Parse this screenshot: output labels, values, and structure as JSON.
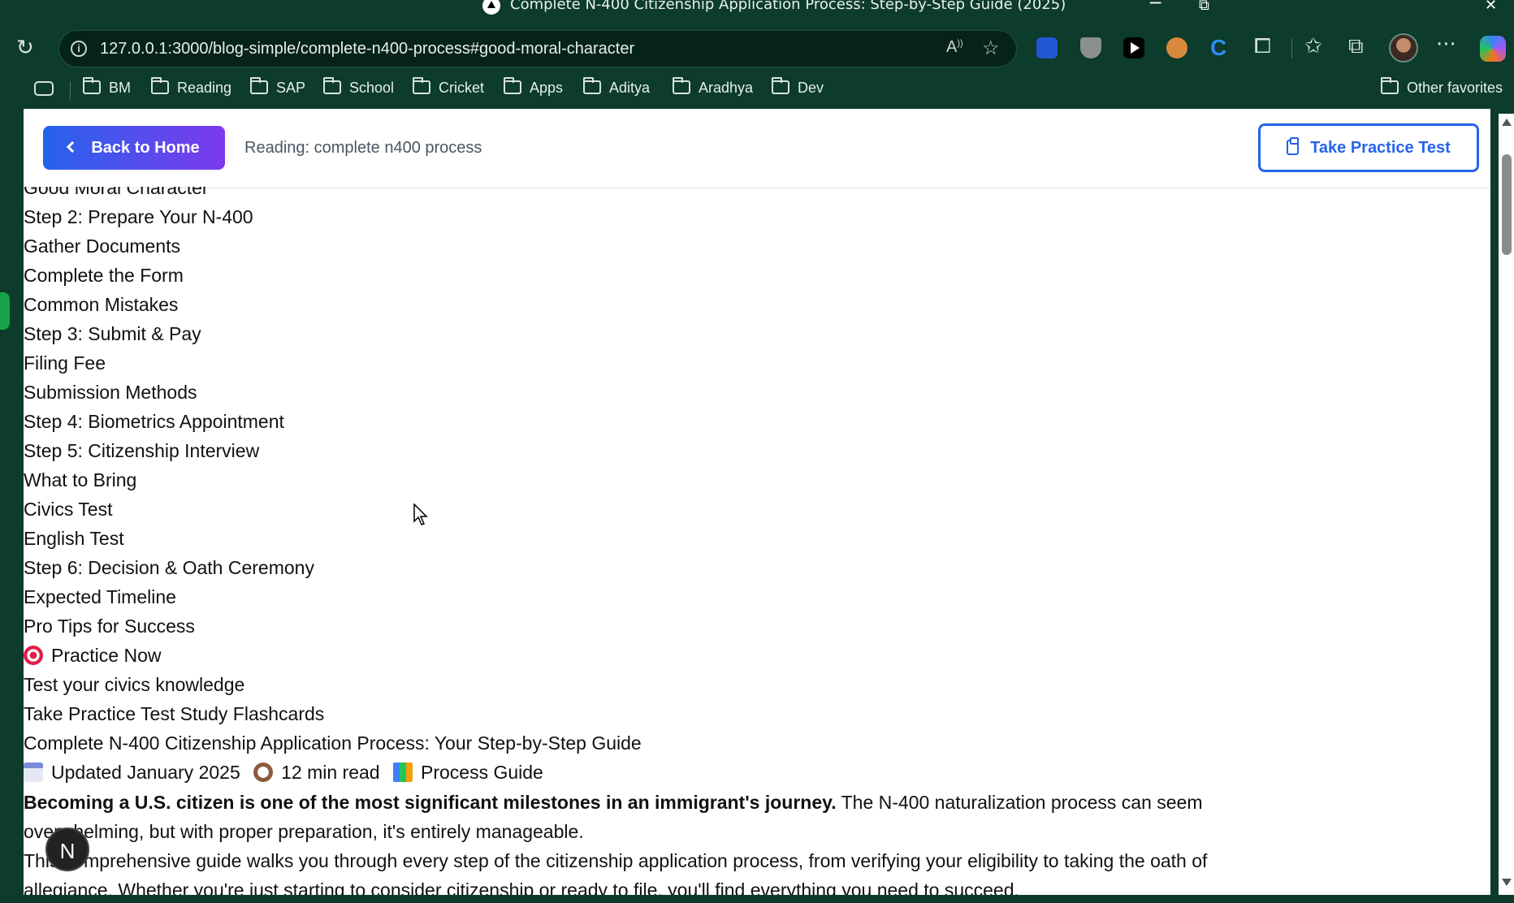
{
  "window": {
    "title": "Complete N-400 Citizenship Application Process: Step-by-Step Guide (2025)",
    "minimize": "─",
    "restore": "⧉",
    "close": "✕"
  },
  "toolbar": {
    "url": "127.0.0.1:3000/blog-simple/complete-n400-process#good-moral-character",
    "read_aloud": "A⁾",
    "more": "···"
  },
  "bookmarks": {
    "items": [
      "BM",
      "Reading",
      "SAP",
      "School",
      "Cricket",
      "Apps",
      "Aditya",
      "Aradhya",
      "Dev"
    ],
    "other": "Other favorites"
  },
  "header": {
    "back_label": "Back to Home",
    "reading_label": "Reading: complete n400 process",
    "practice_label": "Take Practice Test"
  },
  "content": {
    "toc": [
      "Good Moral Character",
      "Step 2: Prepare Your N-400",
      "Gather Documents",
      "Complete the Form",
      "Common Mistakes",
      "Step 3: Submit & Pay",
      "Filing Fee",
      "Submission Methods",
      "Step 4: Biometrics Appointment",
      "Step 5: Citizenship Interview",
      "What to Bring",
      "Civics Test",
      "English Test",
      "Step 6: Decision & Oath Ceremony",
      "Expected Timeline",
      "Pro Tips for Success"
    ],
    "practice_now": "Practice Now",
    "practice_sub": "Test your civics knowledge",
    "practice_links": "Take Practice Test Study Flashcards",
    "article_title": "Complete N-400 Citizenship Application Process: Your Step-by-Step Guide",
    "meta_updated": "Updated January 2025",
    "meta_read": "12 min read",
    "meta_category": "Process Guide",
    "intro_bold": "Becoming a U.S. citizen is one of the most significant milestones in an immigrant's journey.",
    "intro_rest": " The N-400 naturalization process can seem overwhelming, but with proper preparation, it's entirely manageable.",
    "intro_2": "This comprehensive guide walks you through every step of the citizenship application process, from verifying your eligibility to taking the oath of allegiance. Whether you're just starting to consider citizenship or ready to file, you'll find everything you need to succeed."
  },
  "floating_avatar": "N",
  "icons": [
    "info-icon",
    "read-aloud-icon",
    "star-icon",
    "bitwarden-icon",
    "ublock-icon",
    "youtube-icon",
    "glasses-icon",
    "c-icon",
    "extensions-icon",
    "favorites-icon",
    "collections-icon",
    "avatar",
    "more-icon",
    "copilot-icon",
    "folder-icon",
    "chevron-left-icon",
    "clipboard-icon",
    "target-icon",
    "calendar-icon",
    "stopwatch-icon",
    "books-icon"
  ]
}
